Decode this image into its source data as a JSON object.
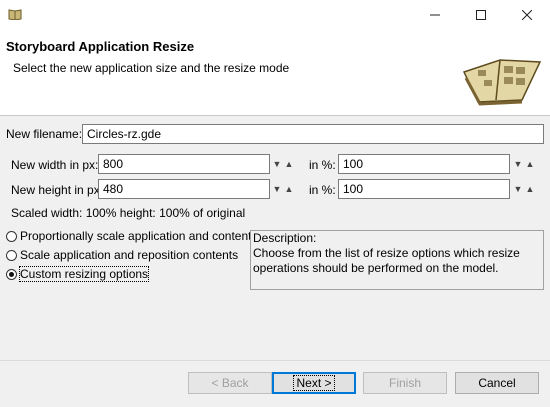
{
  "window": {
    "minimize_glyph": "—",
    "maximize_glyph": "☐",
    "close_glyph": "✕"
  },
  "header": {
    "title": "Storyboard Application Resize",
    "subtitle": "Select the new application size and the resize mode"
  },
  "form": {
    "filename_label": "New filename:",
    "filename_value": "Circles-rz.gde",
    "width_label": "New width in px:",
    "width_value": "800",
    "width_pct_label": "in %:",
    "width_pct_value": "100",
    "height_label": "New height in px:",
    "height_value": "480",
    "height_pct_label": "in %:",
    "height_pct_value": "100",
    "scaled_info": "Scaled width: 100%  height: 100% of original"
  },
  "options": [
    {
      "label": "Proportionally scale application and contents",
      "selected": false
    },
    {
      "label": "Scale application and reposition contents",
      "selected": false
    },
    {
      "label": "Custom resizing options",
      "selected": true
    }
  ],
  "description": {
    "heading": "Description:",
    "text": "Choose from the list of resize options which resize operations should be performed on the model."
  },
  "buttons": {
    "back": "< Back",
    "next": "Next >",
    "finish": "Finish",
    "cancel": "Cancel"
  },
  "colors": {
    "accent": "#0078d7"
  }
}
